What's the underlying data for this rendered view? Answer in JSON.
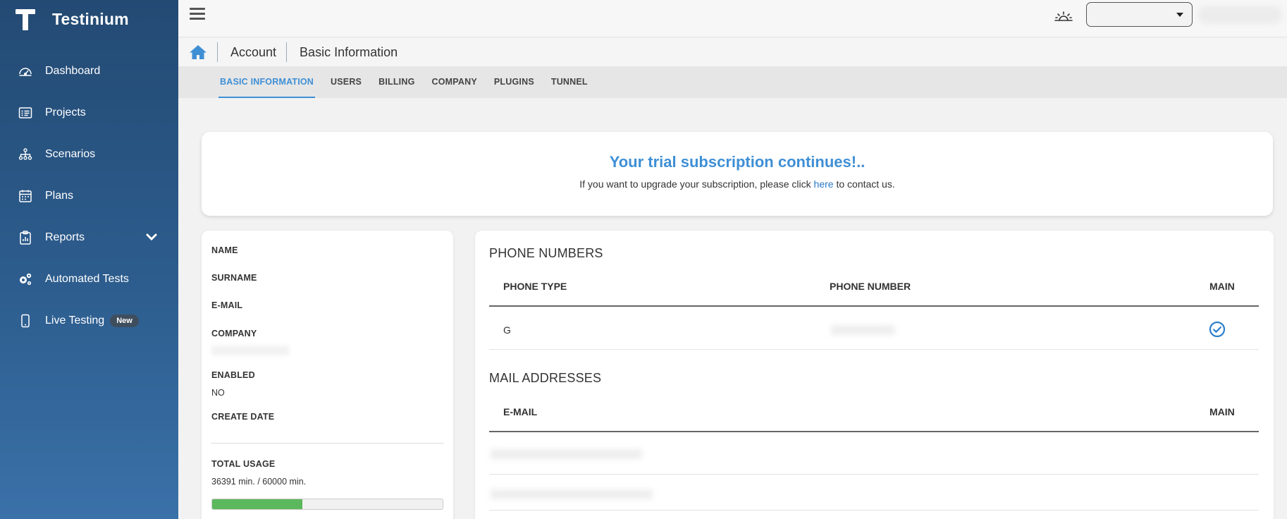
{
  "app": {
    "name": "Testinium"
  },
  "sidebar": {
    "items": [
      {
        "label": "Dashboard",
        "icon": "dashboard-icon"
      },
      {
        "label": "Projects",
        "icon": "projects-icon"
      },
      {
        "label": "Scenarios",
        "icon": "scenarios-icon"
      },
      {
        "label": "Plans",
        "icon": "plans-icon"
      },
      {
        "label": "Reports",
        "icon": "reports-icon",
        "expandable": true
      },
      {
        "label": "Automated Tests",
        "icon": "gears-icon"
      },
      {
        "label": "Live Testing",
        "icon": "mobile-icon",
        "badge": "New"
      }
    ]
  },
  "breadcrumb": {
    "items": [
      "Account",
      "Basic Information"
    ]
  },
  "tabs": {
    "items": [
      "BASIC INFORMATION",
      "USERS",
      "BILLING",
      "COMPANY",
      "PLUGINS",
      "TUNNEL"
    ],
    "active": "BASIC INFORMATION"
  },
  "trial": {
    "title": "Your trial subscription continues!..",
    "text_before": "If you want to upgrade your subscription, please click ",
    "link": "here",
    "text_after": " to contact us."
  },
  "info": {
    "name_label": "NAME",
    "surname_label": "SURNAME",
    "email_label": "E-MAIL",
    "company_label": "COMPANY",
    "enabled_label": "ENABLED",
    "enabled_value": "NO",
    "create_date_label": "CREATE DATE",
    "total_usage_label": "TOTAL USAGE",
    "total_usage_value": "36391 min. / 60000 min.",
    "usage_fraction": 0.3927
  },
  "phones": {
    "title": "PHONE NUMBERS",
    "headers": [
      "PHONE TYPE",
      "PHONE NUMBER",
      "MAIN"
    ],
    "rows": [
      {
        "type": "G",
        "main": true
      }
    ]
  },
  "mails": {
    "title": "MAIL ADDRESSES",
    "headers": [
      "E-MAIL",
      "MAIN"
    ]
  },
  "colors": {
    "accent": "#3f8fd5",
    "sidebar": "#2d5d8e",
    "progress": "#5cb85c"
  }
}
